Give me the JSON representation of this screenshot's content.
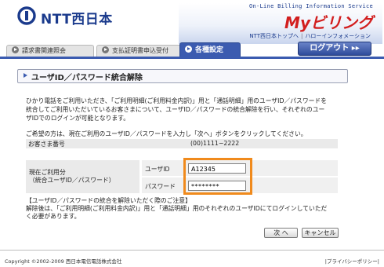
{
  "header": {
    "logo_text": "NTT西日本",
    "online_info": "On-Line Billing Information Service",
    "brand": "Myビリング",
    "top_links": [
      "NTT西日本トップへ",
      "ハローインフォメーション"
    ]
  },
  "tabs": [
    {
      "label": "請求書関連照会"
    },
    {
      "label": "支払証明書申込受付"
    },
    {
      "label": "各種設定"
    }
  ],
  "logout_label": "ログアウト ▸▸",
  "page_title": "ユーザID／パスワード統合解除",
  "description": [
    "ひかり電話をご利用いただき、「ご利用明細(ご利用料金内訳)」用と「通話明細」用のユーザID／パスワードを",
    "統合してご利用いただいているお客さまについて、ユーザID／パスワードの統合解除を行い、それぞれのユー",
    "ザIDでのログインが可能となります。"
  ],
  "instruction": "ご希望の方は、現在ご利用のユーザID／パスワードを入力し「次へ」ボタンをクリックしてください。",
  "account": {
    "label": "お客さま番号",
    "value": "(00)1111−2222"
  },
  "credentials": {
    "section_label_1": "現在ご利用分",
    "section_label_2": "（統合ユーザID／パスワード）",
    "user_id_label": "ユーザID",
    "user_id_value": "A12345",
    "password_label": "パスワード",
    "password_value": "********"
  },
  "notice": [
    "【ユーザID／パスワードの統合を解除いただく際のご注意】",
    "解除後は、「ご利用明細(ご利用料金内訳)」用と「通話明細」用のそれぞれのユーザIDにてログインしていただ",
    "く必要があります。"
  ],
  "buttons": {
    "next": "次 へ",
    "cancel": "キャンセル"
  },
  "footer": {
    "copyright": "Copyright ©2002-2009 西日本電信電話株式会社",
    "privacy": "|プライバシーポリシー|"
  },
  "colors": {
    "accent": "#3b5bb0",
    "brand": "#d21e1e",
    "highlight": "#f08a1c"
  }
}
